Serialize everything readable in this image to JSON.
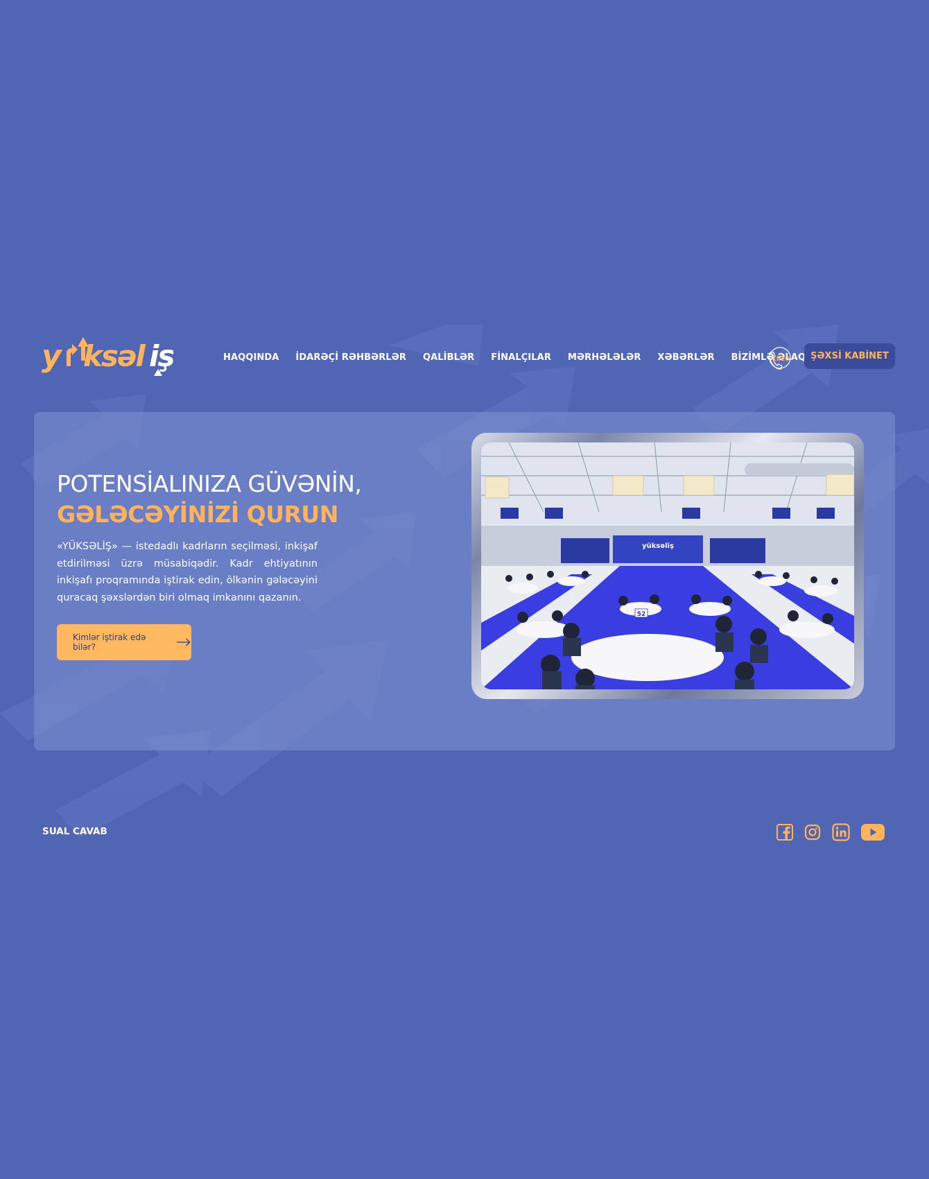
{
  "header": {
    "logo_text": "yüksəliş",
    "nav": [
      "HAQQINDA",
      "İDARƏÇİ RƏHBƏRLƏR",
      "QALİBLƏR",
      "FİNALÇILAR",
      "MƏRHƏLƏLƏR",
      "XƏBƏRLƏR",
      "BİZİMLƏ ƏLAQƏ"
    ],
    "phone_number": "1820",
    "phone_icon": "phone-icon",
    "cabinet_label": "ŞƏXSİ KABİNET"
  },
  "hero": {
    "title_line1": "POTENSİALINIZA GÜVƏNİN,",
    "title_line2": "GƏLƏCƏYİNİZİ QURUN",
    "description": "«YÜKSƏLİŞ» — istedadlı kadrların seçilməsi, inkişaf etdirilməsi üzrə müsabiqədir. Kadr ehtiyatının inkişafı proqramında iştirak edin, ölkənin gələcəyini quracaq şəxslərdən biri olmaq imkanını qazanın.",
    "cta_label": "Kimlər iştirak edə bilər?",
    "cta_icon": "arrow-right-icon",
    "photo_table_number": "52"
  },
  "footer": {
    "faq_label": "SUAL CAVAB",
    "socials": [
      "facebook-icon",
      "instagram-icon",
      "linkedin-icon",
      "youtube-icon"
    ]
  },
  "colors": {
    "background": "#5066b5",
    "accent": "#ffb35c",
    "button_dark": "#3a4b99",
    "card": "#7585c8"
  }
}
